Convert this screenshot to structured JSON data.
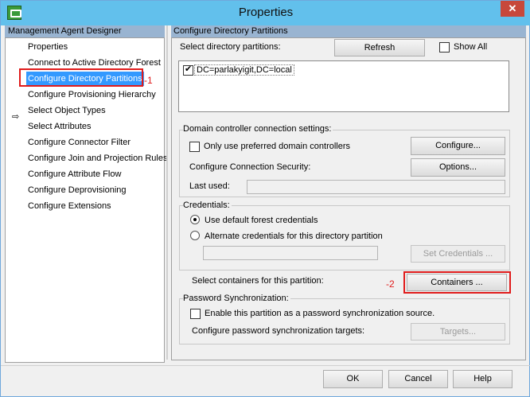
{
  "window": {
    "title": "Properties",
    "close_label": "✕"
  },
  "left": {
    "header": "Management Agent Designer",
    "items": [
      "Properties",
      "Connect to Active Directory Forest",
      "Configure Directory Partitions",
      "Configure Provisioning Hierarchy",
      "Select Object Types",
      "Select Attributes",
      "Configure Connector Filter",
      "Configure Join and Projection Rules",
      "Configure Attribute Flow",
      "Configure Deprovisioning",
      "Configure Extensions"
    ],
    "selected_index": 2,
    "arrow_glyph": "⇨",
    "annotation": "-1"
  },
  "right": {
    "header": "Configure Directory Partitions",
    "select_partitions_label": "Select directory partitions:",
    "refresh_label": "Refresh",
    "show_all_label": "Show All",
    "partitions": [
      {
        "name": "DC=parlakyigit,DC=local",
        "checked": true
      }
    ],
    "dc_group": {
      "title": "Domain controller connection settings:",
      "preferred_only_label": "Only use preferred domain controllers",
      "configure_label": "Configure...",
      "conn_security_label": "Configure Connection Security:",
      "options_label": "Options...",
      "last_used_label": "Last used:"
    },
    "credentials": {
      "title": "Credentials:",
      "default_label": "Use default forest credentials",
      "alternate_label": "Alternate credentials for this directory partition",
      "set_credentials_label": "Set Credentials ..."
    },
    "containers": {
      "label": "Select containers for this partition:",
      "button_label": "Containers ...",
      "annotation": "-2"
    },
    "password_sync": {
      "title": "Password Synchronization:",
      "enable_label": "Enable this partition as a password synchronization source.",
      "targets_config_label": "Configure password synchronization targets:",
      "targets_label": "Targets..."
    }
  },
  "footer": {
    "ok_label": "OK",
    "cancel_label": "Cancel",
    "help_label": "Help"
  },
  "colors": {
    "titlebar": "#62c0ec",
    "header": "#99b4d1",
    "selection": "#3399ff",
    "annotation": "#e01b1b"
  }
}
